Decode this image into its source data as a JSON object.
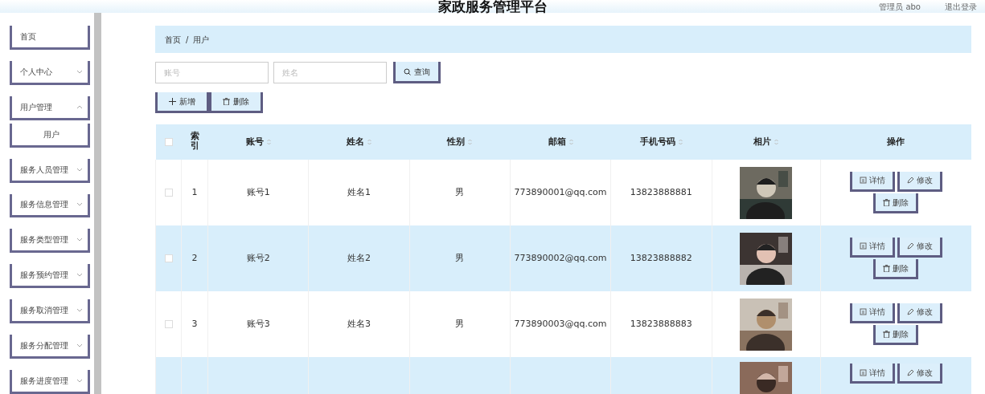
{
  "header": {
    "title": "家政服务管理平台",
    "user": "管理员 abo",
    "logout": "退出登录"
  },
  "sidebar": {
    "items": [
      {
        "label": "首页"
      },
      {
        "label": "个人中心",
        "expanded": false
      },
      {
        "label": "用户管理",
        "expanded": true,
        "children": [
          {
            "label": "用户"
          }
        ]
      },
      {
        "label": "服务人员管理",
        "expanded": false
      },
      {
        "label": "服务信息管理",
        "expanded": false
      },
      {
        "label": "服务类型管理",
        "expanded": false
      },
      {
        "label": "服务预约管理",
        "expanded": false
      },
      {
        "label": "服务取消管理",
        "expanded": false
      },
      {
        "label": "服务分配管理",
        "expanded": false
      },
      {
        "label": "服务进度管理",
        "expanded": false
      }
    ]
  },
  "breadcrumb": {
    "items": [
      "首页",
      "用户"
    ],
    "separator": "/"
  },
  "search": {
    "fields": [
      {
        "placeholder": "账号"
      },
      {
        "placeholder": "姓名"
      }
    ],
    "button": "查询"
  },
  "toolbar": [
    {
      "kind": "add",
      "label": "新增"
    },
    {
      "kind": "delete",
      "label": "删除"
    }
  ],
  "table": {
    "all_checked": false,
    "columns": [
      {
        "label": "索引",
        "kind": "plain"
      },
      {
        "label": "账号",
        "kind": "sortable"
      },
      {
        "label": "姓名",
        "kind": "sortable"
      },
      {
        "label": "性别",
        "kind": "sortable"
      },
      {
        "label": "邮箱",
        "kind": "sortable"
      },
      {
        "label": "手机号码",
        "kind": "sortable"
      },
      {
        "label": "相片",
        "kind": "sortable"
      },
      {
        "label": "操作",
        "kind": "plain"
      }
    ],
    "rows": [
      {
        "checked": false,
        "index": "1",
        "account": "账号1",
        "name": "姓名1",
        "gender": "男",
        "email": "773890001@qq.com",
        "phone": "13823888881",
        "photo": {
          "kind": "picture"
        },
        "actions": [
          {
            "kind": "detail",
            "label": "详情"
          },
          {
            "kind": "edit",
            "label": "修改"
          },
          {
            "kind": "delete",
            "label": "删除"
          }
        ]
      },
      {
        "checked": false,
        "index": "2",
        "account": "账号2",
        "name": "姓名2",
        "gender": "男",
        "email": "773890002@qq.com",
        "phone": "13823888882",
        "photo": {
          "kind": "picture"
        },
        "actions": [
          {
            "kind": "detail",
            "label": "详情"
          },
          {
            "kind": "edit",
            "label": "修改"
          },
          {
            "kind": "delete",
            "label": "删除"
          }
        ]
      },
      {
        "checked": false,
        "index": "3",
        "account": "账号3",
        "name": "姓名3",
        "gender": "男",
        "email": "773890003@qq.com",
        "phone": "13823888883",
        "photo": {
          "kind": "picture"
        },
        "actions": [
          {
            "kind": "detail",
            "label": "详情"
          },
          {
            "kind": "edit",
            "label": "修改"
          },
          {
            "kind": "delete",
            "label": "删除"
          }
        ]
      },
      {
        "photo": {
          "kind": "picture"
        },
        "actions": [
          {
            "kind": "detail",
            "label": "详情"
          },
          {
            "kind": "edit",
            "label": "修改"
          }
        ]
      }
    ]
  }
}
